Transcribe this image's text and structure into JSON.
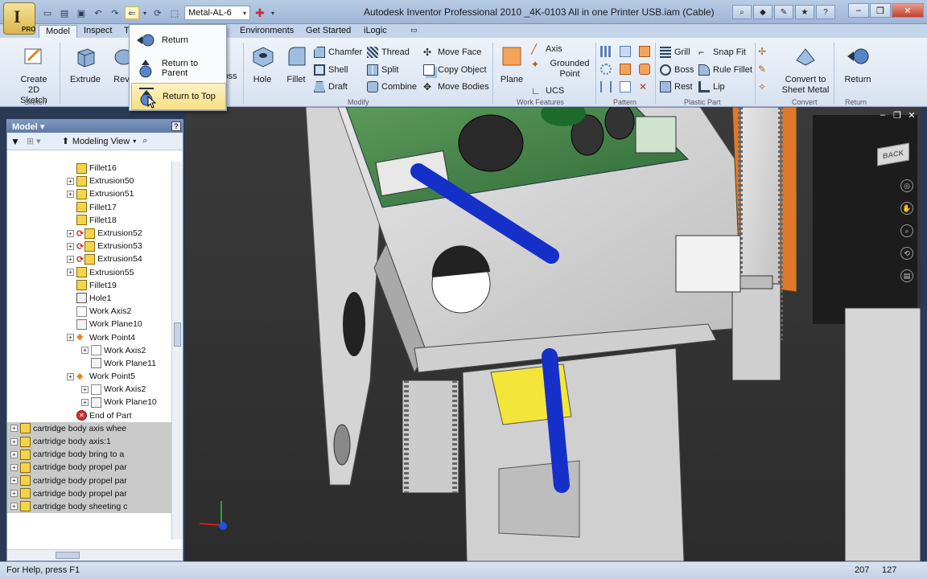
{
  "window": {
    "title": "Autodesk Inventor Professional 2010    _4K-0103 All in one Printer USB.iam (Cable)"
  },
  "quick_access": {
    "material_combo": "Metal-AL-6",
    "items": [
      "new-icon",
      "open-icon",
      "save-icon",
      "undo-icon",
      "redo-icon",
      "return-icon",
      "update-icon",
      "select-icon"
    ]
  },
  "ribbon_tabs": [
    {
      "label": "Model"
    },
    {
      "label": "Inspect"
    },
    {
      "label": "T"
    },
    {
      "label": "Environments"
    },
    {
      "label": "Get Started"
    },
    {
      "label": "iLogic"
    }
  ],
  "ribbon": {
    "create_sketch": "Create 2D Sketch",
    "extrude": "Extrude",
    "revolve": "Revo",
    "loft": "oss",
    "hole": "Hole",
    "fillet": "Fillet",
    "chamfer": "Chamfer",
    "shell": "Shell",
    "draft": "Draft",
    "thread": "Thread",
    "split": "Split",
    "combine": "Combine",
    "move_face": "Move Face",
    "copy_object": "Copy Object",
    "move_bodies": "Move Bodies",
    "plane": "Plane",
    "axis": "Axis",
    "grounded_point": "Grounded Point",
    "ucs": "UCS",
    "grill": "Grill",
    "boss": "Boss",
    "rest": "Rest",
    "snap_fit": "Snap Fit",
    "rule_fillet": "Rule Fillet",
    "lip": "Lip",
    "convert_sheet_metal": "Convert to Sheet Metal",
    "return": "Return",
    "panel_labels": [
      "Sketch",
      "Modify",
      "Work Features",
      "Pattern",
      "Plastic Part",
      "Convert",
      "Return"
    ]
  },
  "return_menu": {
    "items": [
      {
        "label": "Return",
        "highlighted": false
      },
      {
        "label": "Return to Parent",
        "highlighted": false
      },
      {
        "label": "Return to Top",
        "highlighted": true
      }
    ]
  },
  "browser": {
    "header": "Model",
    "view": "Modeling View",
    "items": [
      {
        "label": "Fillet16",
        "indent": 1,
        "expander": false,
        "icon": "fillet",
        "grey": false
      },
      {
        "label": "Extrusion50",
        "indent": 0,
        "expander": true,
        "icon": "extrusion",
        "grey": false
      },
      {
        "label": "Extrusion51",
        "indent": 0,
        "expander": true,
        "icon": "extrusion",
        "grey": false
      },
      {
        "label": "Fillet17",
        "indent": 1,
        "expander": false,
        "icon": "fillet",
        "grey": false
      },
      {
        "label": "Fillet18",
        "indent": 1,
        "expander": false,
        "icon": "fillet",
        "grey": false
      },
      {
        "label": "Extrusion52",
        "indent": 0,
        "expander": true,
        "icon": "extrusion-rebuild",
        "grey": false
      },
      {
        "label": "Extrusion53",
        "indent": 0,
        "expander": true,
        "icon": "extrusion-rebuild",
        "grey": false
      },
      {
        "label": "Extrusion54",
        "indent": 0,
        "expander": true,
        "icon": "extrusion-rebuild",
        "grey": false
      },
      {
        "label": "Extrusion55",
        "indent": 0,
        "expander": true,
        "icon": "extrusion",
        "grey": false
      },
      {
        "label": "Fillet19",
        "indent": 1,
        "expander": false,
        "icon": "fillet",
        "grey": false
      },
      {
        "label": "Hole1",
        "indent": 1,
        "expander": false,
        "icon": "hole",
        "grey": false
      },
      {
        "label": "Work Axis2",
        "indent": 1,
        "expander": false,
        "icon": "work-axis",
        "grey": false
      },
      {
        "label": "Work Plane10",
        "indent": 1,
        "expander": false,
        "icon": "work-plane",
        "grey": false
      },
      {
        "label": "Work Point4",
        "indent": 0,
        "expander": true,
        "icon": "work-point",
        "grey": false
      },
      {
        "label": "Work Axis2",
        "indent": 2,
        "expander": true,
        "icon": "work-axis",
        "grey": false
      },
      {
        "label": "Work Plane11",
        "indent": 2,
        "expander": false,
        "icon": "work-plane",
        "grey": false
      },
      {
        "label": "Work Point5",
        "indent": 0,
        "expander": true,
        "icon": "work-point",
        "grey": false
      },
      {
        "label": "Work Axis2",
        "indent": 2,
        "expander": true,
        "icon": "work-axis",
        "grey": false
      },
      {
        "label": "Work Plane10",
        "indent": 2,
        "expander": true,
        "icon": "work-plane",
        "grey": false
      },
      {
        "label": "End of Part",
        "indent": 1,
        "expander": false,
        "icon": "end-of-part",
        "grey": false
      },
      {
        "label": "cartridge body axis whee",
        "indent": 0,
        "expander": true,
        "icon": "part",
        "grey": true
      },
      {
        "label": "cartridge body axis:1",
        "indent": 0,
        "expander": true,
        "icon": "part-adaptive",
        "grey": true
      },
      {
        "label": "cartridge body bring to a",
        "indent": 0,
        "expander": true,
        "icon": "part-adaptive",
        "grey": true
      },
      {
        "label": "cartridge body propel par",
        "indent": 0,
        "expander": true,
        "icon": "part",
        "grey": true
      },
      {
        "label": "cartridge body propel par",
        "indent": 0,
        "expander": true,
        "icon": "part",
        "grey": true
      },
      {
        "label": "cartridge body propel par",
        "indent": 0,
        "expander": true,
        "icon": "part-adaptive",
        "grey": true
      },
      {
        "label": "cartridge body sheeting c",
        "indent": 0,
        "expander": true,
        "icon": "part-adaptive",
        "grey": true
      }
    ]
  },
  "viewcube": {
    "label": "BACK"
  },
  "status": {
    "help": "For Help, press F1",
    "count1": "207",
    "count2": "127"
  },
  "colors": {
    "cable": "#1530c8",
    "board": "#3a7a40",
    "chassis": "#dcdcdc",
    "gear": "#c8c8c8",
    "orange": "#e0782c",
    "cartridge": "#f3e53a"
  }
}
